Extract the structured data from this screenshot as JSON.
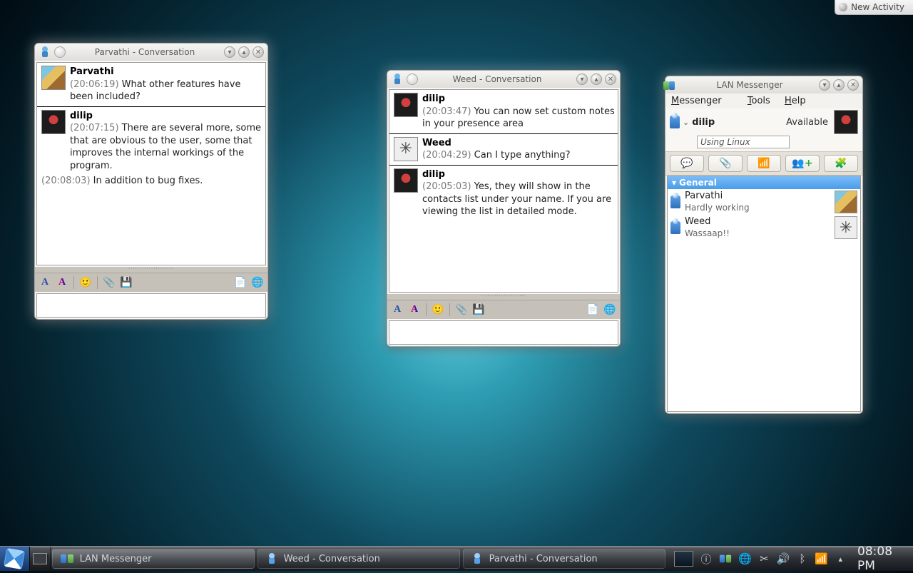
{
  "new_activity_label": "New Activity",
  "windows": {
    "conv1": {
      "title": "Parvathi - Conversation",
      "messages": [
        {
          "sender": "Parvathi",
          "time": "(20:06:19)",
          "text": "What other features have been included?",
          "avatar": "stairs"
        },
        {
          "sender": "dilip",
          "time": "(20:07:15)",
          "text": "There are several more, some that are obvious to the user, some that improves the internal workings of the program.",
          "avatar": "disc",
          "cont_time": "(20:08:03)",
          "cont_text": "In addition to bug fixes."
        }
      ]
    },
    "conv2": {
      "title": "Weed - Conversation",
      "messages": [
        {
          "sender": "dilip",
          "time": "(20:03:47)",
          "text": "You can now set custom notes in your presence area",
          "avatar": "disc"
        },
        {
          "sender": "Weed",
          "time": "(20:04:29)",
          "text": "Can I type anything?",
          "avatar": "bot"
        },
        {
          "sender": "dilip",
          "time": "(20:05:03)",
          "text": "Yes, they will show in the contacts list under your name. If you are viewing the list in detailed mode.",
          "avatar": "disc"
        }
      ]
    },
    "messenger": {
      "title": "LAN Messenger",
      "menu": {
        "messenger": "Messenger",
        "tools": "Tools",
        "help": "Help"
      },
      "presence": {
        "name": "dilip",
        "status": "Available",
        "note": "Using Linux"
      },
      "group": "General",
      "contacts": [
        {
          "name": "Parvathi",
          "sub": "Hardly working",
          "avatar": "stairs"
        },
        {
          "name": "Weed",
          "sub": "Wassaap!!",
          "avatar": "bot"
        }
      ]
    }
  },
  "taskbar": {
    "items": [
      {
        "label": "LAN Messenger",
        "icon": "lan"
      },
      {
        "label": "Weed - Conversation",
        "icon": "chat"
      },
      {
        "label": "Parvathi - Conversation",
        "icon": "chat"
      }
    ],
    "clock": "08:08 PM"
  }
}
